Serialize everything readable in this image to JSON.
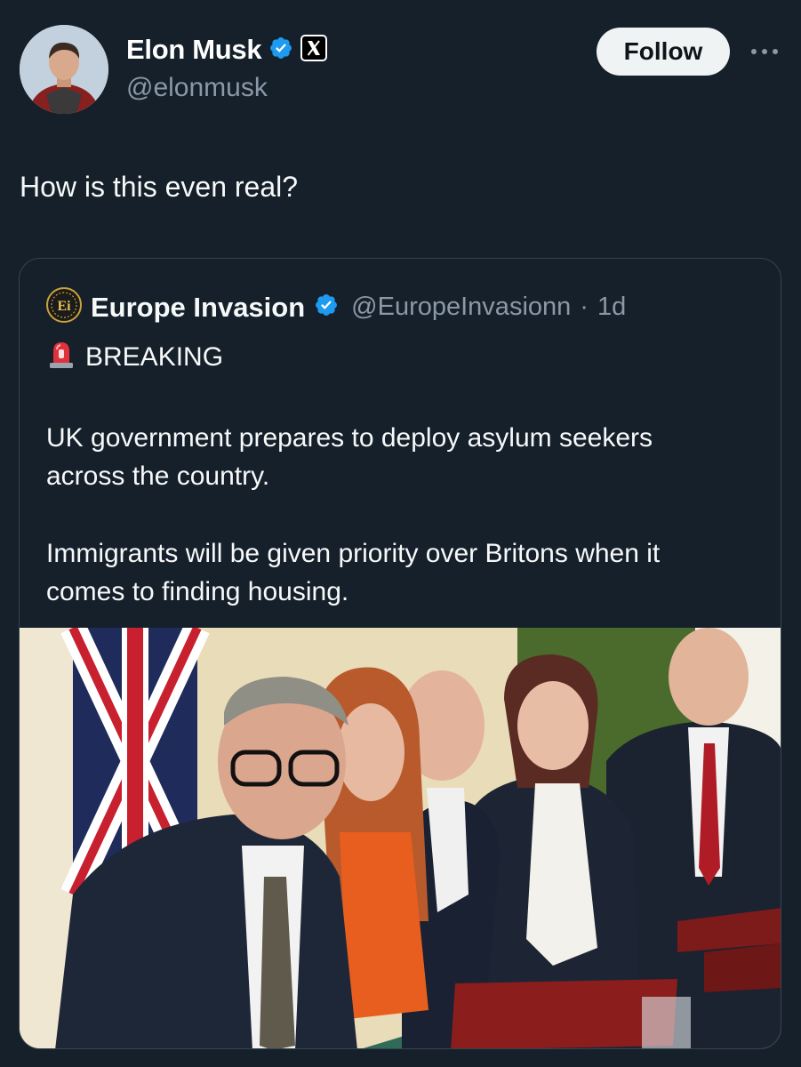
{
  "author": {
    "name": "Elon Musk",
    "handle": "@elonmusk",
    "verified": true,
    "affiliate_badge": "X"
  },
  "follow_button": {
    "label": "Follow"
  },
  "more_icon": "more-horizontal-icon",
  "tweet": {
    "text": "How is this even real?"
  },
  "quoted": {
    "avatar_initials": "Ei",
    "name": "Europe Invasion",
    "handle": "@EuropeInvasionn",
    "separator": "·",
    "time": "1d",
    "verified": true,
    "breaking": "BREAKING",
    "paragraph1_line1": "UK government prepares to deploy asylum seekers",
    "paragraph1_line2": "across the country.",
    "paragraph2_line1": "Immigrants will be given priority over Britons when it",
    "paragraph2_line2": "comes to finding housing."
  },
  "colors": {
    "background": "#15202b",
    "verified_blue": "#1d9bf0",
    "secondary_text": "#8b98a5",
    "border": "#38444d"
  }
}
